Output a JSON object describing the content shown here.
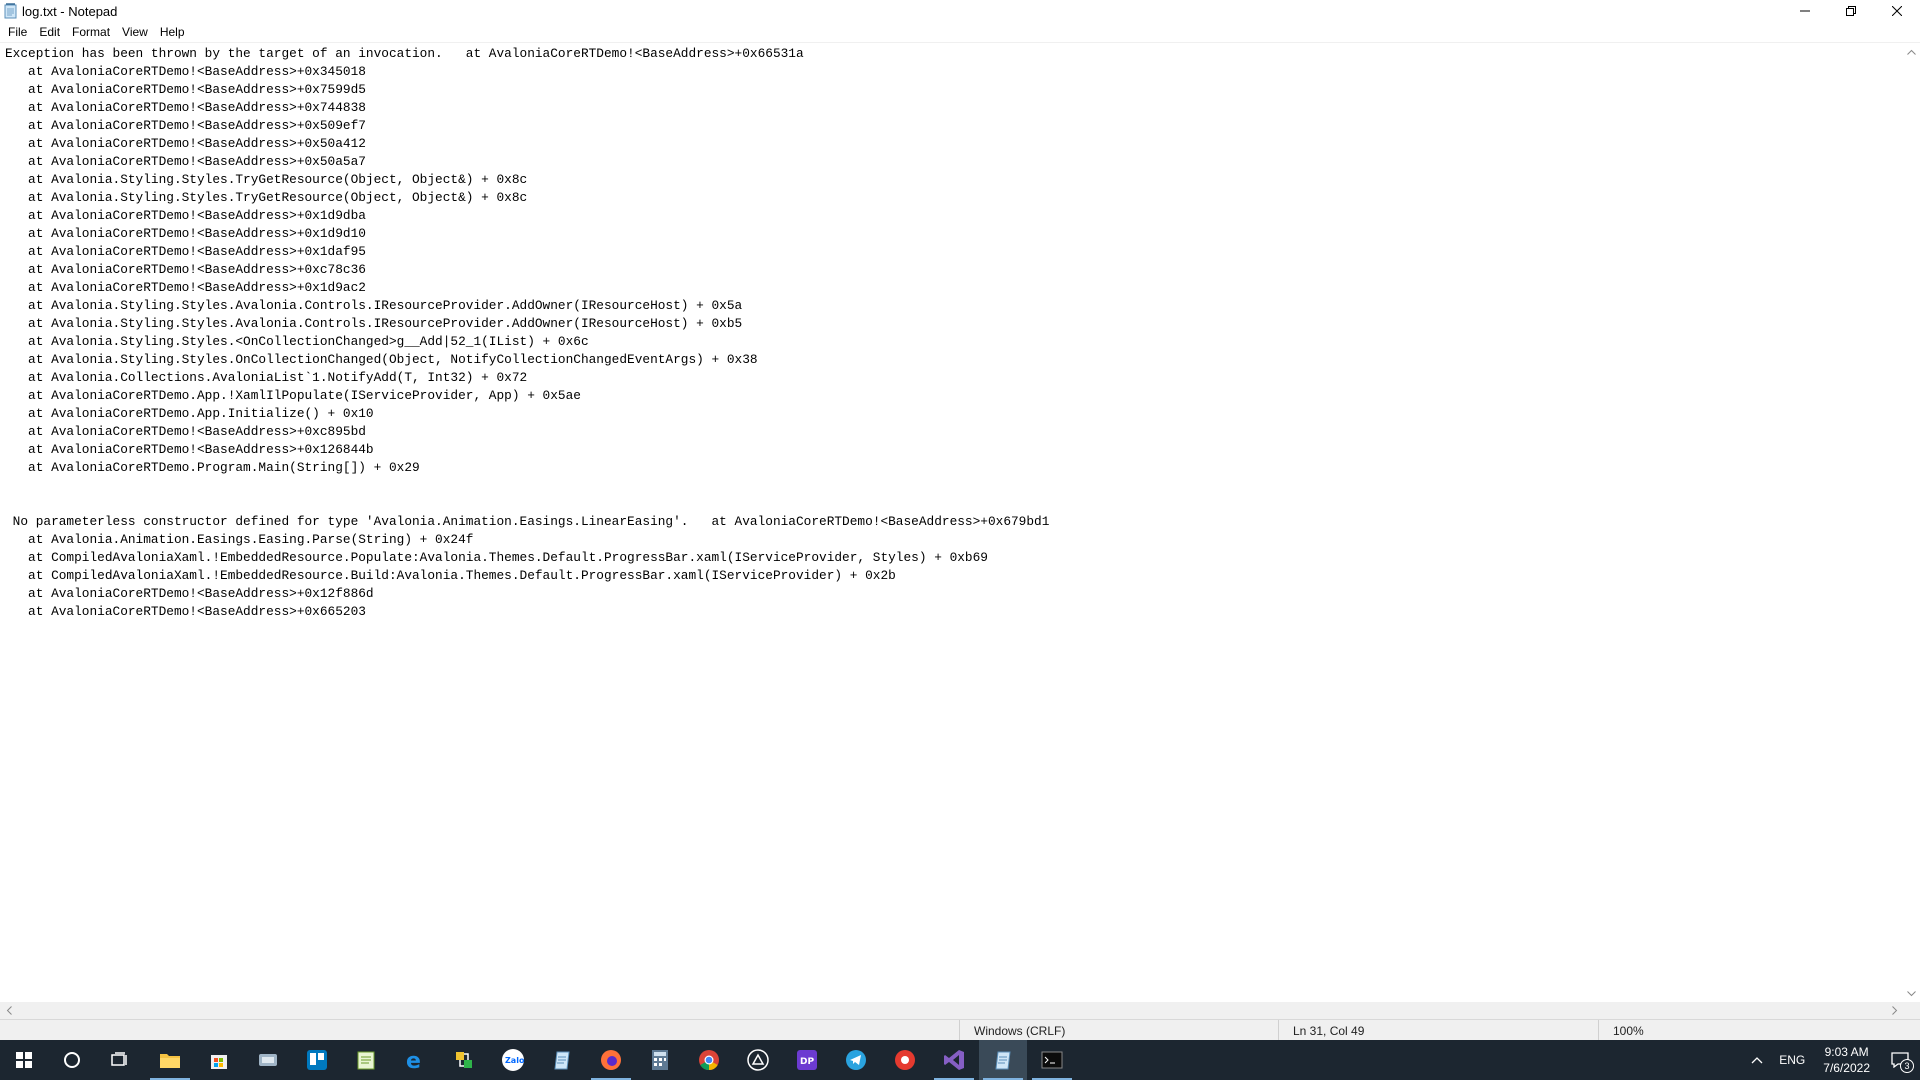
{
  "window": {
    "title": "log.txt - Notepad"
  },
  "menu": [
    "File",
    "Edit",
    "Format",
    "View",
    "Help"
  ],
  "editor": {
    "lines": [
      "Exception has been thrown by the target of an invocation.   at AvaloniaCoreRTDemo!<BaseAddress>+0x66531a",
      "   at AvaloniaCoreRTDemo!<BaseAddress>+0x345018",
      "   at AvaloniaCoreRTDemo!<BaseAddress>+0x7599d5",
      "   at AvaloniaCoreRTDemo!<BaseAddress>+0x744838",
      "   at AvaloniaCoreRTDemo!<BaseAddress>+0x509ef7",
      "   at AvaloniaCoreRTDemo!<BaseAddress>+0x50a412",
      "   at AvaloniaCoreRTDemo!<BaseAddress>+0x50a5a7",
      "   at Avalonia.Styling.Styles.TryGetResource(Object, Object&) + 0x8c",
      "   at Avalonia.Styling.Styles.TryGetResource(Object, Object&) + 0x8c",
      "   at AvaloniaCoreRTDemo!<BaseAddress>+0x1d9dba",
      "   at AvaloniaCoreRTDemo!<BaseAddress>+0x1d9d10",
      "   at AvaloniaCoreRTDemo!<BaseAddress>+0x1daf95",
      "   at AvaloniaCoreRTDemo!<BaseAddress>+0xc78c36",
      "   at AvaloniaCoreRTDemo!<BaseAddress>+0x1d9ac2",
      "   at Avalonia.Styling.Styles.Avalonia.Controls.IResourceProvider.AddOwner(IResourceHost) + 0x5a",
      "   at Avalonia.Styling.Styles.Avalonia.Controls.IResourceProvider.AddOwner(IResourceHost) + 0xb5",
      "   at Avalonia.Styling.Styles.<OnCollectionChanged>g__Add|52_1(IList) + 0x6c",
      "   at Avalonia.Styling.Styles.OnCollectionChanged(Object, NotifyCollectionChangedEventArgs) + 0x38",
      "   at Avalonia.Collections.AvaloniaList`1.NotifyAdd(T, Int32) + 0x72",
      "   at AvaloniaCoreRTDemo.App.!XamlIlPopulate(IServiceProvider, App) + 0x5ae",
      "   at AvaloniaCoreRTDemo.App.Initialize() + 0x10",
      "   at AvaloniaCoreRTDemo!<BaseAddress>+0xc895bd",
      "   at AvaloniaCoreRTDemo!<BaseAddress>+0x126844b",
      "   at AvaloniaCoreRTDemo.Program.Main(String[]) + 0x29",
      "",
      "",
      " No parameterless constructor defined for type 'Avalonia.Animation.Easings.LinearEasing'.   at AvaloniaCoreRTDemo!<BaseAddress>+0x679bd1",
      "   at Avalonia.Animation.Easings.Easing.Parse(String) + 0x24f",
      "   at CompiledAvaloniaXaml.!EmbeddedResource.Populate:Avalonia.Themes.Default.ProgressBar.xaml(IServiceProvider, Styles) + 0xb69",
      "   at CompiledAvaloniaXaml.!EmbeddedResource.Build:Avalonia.Themes.Default.ProgressBar.xaml(IServiceProvider) + 0x2b",
      "   at AvaloniaCoreRTDemo!<BaseAddress>+0x12f886d",
      "   at AvaloniaCoreRTDemo!<BaseAddress>+0x665203"
    ]
  },
  "statusbar": {
    "line_ending": "Windows (CRLF)",
    "position": "Ln 31, Col 49",
    "zoom": "100%"
  },
  "taskbar": {
    "icons": [
      "windows-start-icon",
      "cortana-search-icon",
      "task-view-icon",
      "file-explorer-icon",
      "store-icon",
      "app-icon",
      "trello-icon",
      "notepadpp-icon",
      "edge-icon",
      "network-tool-icon",
      "zalo-icon",
      "notepad-alt-icon",
      "firefox-icon",
      "calculator-icon",
      "chrome-icon",
      "vpn-icon",
      "profiler-icon",
      "telegram-icon",
      "recorder-icon",
      "visual-studio-icon",
      "notepad-icon",
      "terminal-icon"
    ],
    "language": "ENG",
    "time": "9:03 AM",
    "date": "7/6/2022",
    "notification_count": "3"
  }
}
